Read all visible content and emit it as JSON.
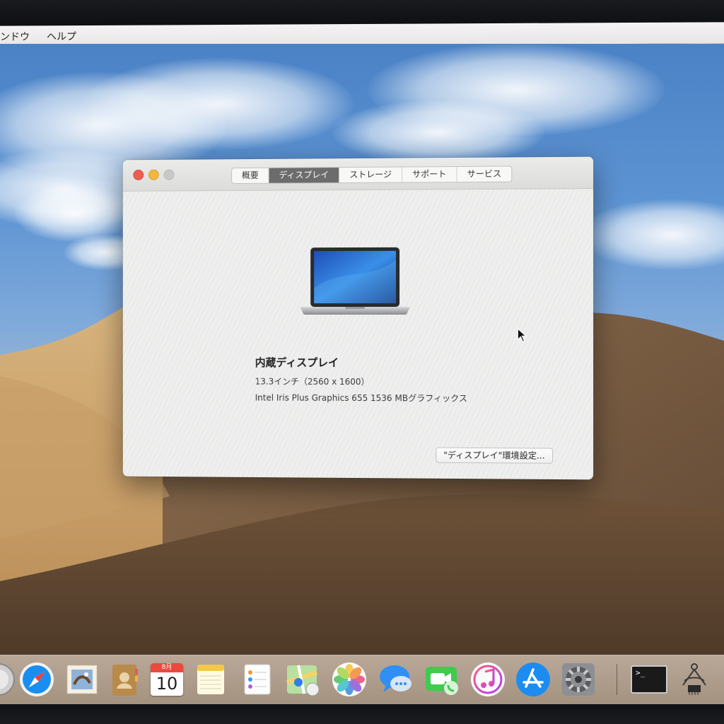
{
  "menubar": {
    "window_label": "ンドウ",
    "help_label": "ヘルプ"
  },
  "window": {
    "tabs": [
      {
        "label": "概要",
        "active": false
      },
      {
        "label": "ディスプレイ",
        "active": true
      },
      {
        "label": "ストレージ",
        "active": false
      },
      {
        "label": "サポート",
        "active": false
      },
      {
        "label": "サービス",
        "active": false
      }
    ],
    "display_name": "内蔵ディスプレイ",
    "resolution": "13.3インチ（2560 x 1600）",
    "graphics": "Intel Iris Plus Graphics 655 1536 MBグラフィックス",
    "prefs_button": "\"ディスプレイ\"環境設定..."
  },
  "calendar": {
    "month": "8月",
    "day": "10"
  },
  "terminal": {
    "prompt": ">_"
  },
  "dock": {
    "items": [
      "finder-icon",
      "safari-icon",
      "mail-icon",
      "contacts-icon",
      "calendar-icon",
      "notes-icon",
      "reminders-icon",
      "maps-icon",
      "photos-icon",
      "messages-icon",
      "facetime-icon",
      "itunes-icon",
      "app-store-icon",
      "system-preferences-icon",
      "terminal-icon",
      "system-information-icon"
    ]
  },
  "colors": {
    "close": "#ee5d52",
    "minimize": "#f3b83a",
    "zoom_inactive": "#c9c9c8",
    "active_tab": "#6c6c6c",
    "sky": "#5c93d2",
    "dune": "#8a6b4a"
  }
}
